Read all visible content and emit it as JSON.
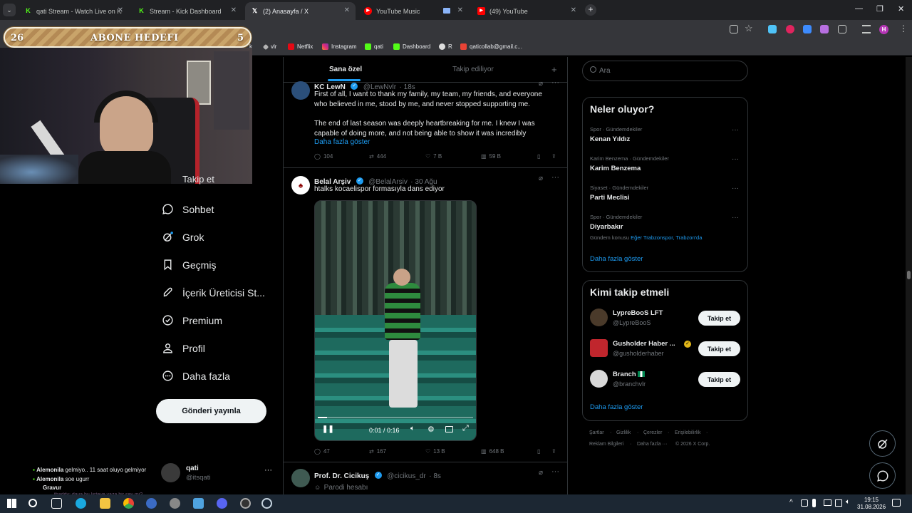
{
  "browser": {
    "tabs": [
      {
        "label": "qati Stream - Watch Live on Kick",
        "icon": "kick-icon",
        "color": "#53fc18"
      },
      {
        "label": "Stream - Kick Dashboard",
        "icon": "kick-icon",
        "color": "#53fc18"
      },
      {
        "label": "(2) Anasayfa / X",
        "icon": "x-icon",
        "color": "#ffffff"
      },
      {
        "label": "YouTube Music",
        "icon": "youtube-music-icon",
        "color": "#ff0000"
      },
      {
        "label": "(49) YouTube",
        "icon": "youtube-icon",
        "color": "#ff0000"
      }
    ],
    "bookmarks": [
      "vlr",
      "Netflix",
      "Instagram",
      "qati",
      "Dashboard",
      "R",
      "qaticollab@gmail.c..."
    ],
    "bookmark_partial": "k"
  },
  "overlay": {
    "goal_title": "ABONE HEDEFI",
    "goal_left": "26",
    "goal_right": "5"
  },
  "x_nav": {
    "partial_item": "Takip et",
    "items": [
      {
        "label": "Sohbet",
        "icon": "chat-icon"
      },
      {
        "label": "Grok",
        "icon": "grok-icon"
      },
      {
        "label": "Geçmiş",
        "icon": "bookmark-icon"
      },
      {
        "label": "İçerik Üreticisi St...",
        "icon": "rocket-icon"
      },
      {
        "label": "Premium",
        "icon": "premium-icon"
      },
      {
        "label": "Profil",
        "icon": "profile-icon"
      },
      {
        "label": "Daha fazla",
        "icon": "more-icon"
      }
    ],
    "post_button": "Gönderi yayınla",
    "account": {
      "name": "qati",
      "handle": "@itsqati"
    }
  },
  "timeline": {
    "tabs": [
      "Sana özel",
      "Takip ediliyor"
    ],
    "tweets": [
      {
        "name": "KC LewN",
        "handle": "@LewNvlr",
        "time": "18s",
        "text1": "First of all, I want to thank my family, my team, my friends, and everyone who believed in me, stood by me, and never stopped supporting me.",
        "text2": "The end of last season was deeply heartbreaking for me. I knew I was capable of doing more, and not being able to show it was incredibly",
        "more": "Daha fazla göster",
        "replies": "104",
        "reposts": "444",
        "likes": "7 B",
        "views": "59 B"
      },
      {
        "name": "Belal Arşiv",
        "handle": "@BelalArsiv",
        "time": "30 Ağu",
        "text1": "htalks kocaelispor formasıyla dans ediyor",
        "video_time": "0:01 / 0:16",
        "video_progress": 0.06,
        "replies": "47",
        "reposts": "167",
        "likes": "13 B",
        "views": "648 B"
      },
      {
        "name": "Prof. Dr. Cicikuş",
        "handle": "@cicikus_dr",
        "time": "8s",
        "text1": "Parodi hesabı"
      }
    ]
  },
  "right": {
    "search_placeholder": "Ara",
    "trends_title": "Neler oluyor?",
    "trends": [
      {
        "context": "Spor · Gündemdekiler",
        "name": "Kenan Yıldız"
      },
      {
        "context": "Karim Benzema · Gündemdekiler",
        "name": "Karim Benzema"
      },
      {
        "context": "Siyaset · Gündemdekiler",
        "name": "Parti Meclisi"
      },
      {
        "context": "Spor · Gündemdekiler",
        "name": "Diyarbakır",
        "topic_prefix": "Gündem konusu",
        "topic": "Eğer Trabzonspor, Trabzon'da"
      }
    ],
    "show_more": "Daha fazla göster",
    "follow_title": "Kimi takip etmeli",
    "follow": [
      {
        "name": "LypreBooS LFT",
        "handle": "@LypreBooS",
        "avatar_color": "#4a3a2a"
      },
      {
        "name": "Gusholder Haber ...",
        "handle": "@gusholderhaber",
        "avatar_color": "#c0262d"
      },
      {
        "name": "Branch",
        "handle": "@branchvlr",
        "avatar_color": "#d8d8d8"
      }
    ],
    "follow_button": "Takip et",
    "footer": [
      "Şartlar",
      "Gizlilik",
      "Çerezler",
      "Erişilebilirlik",
      "Reklam Bilgileri",
      "Daha fazla ···",
      "© 2026 X Corp."
    ]
  },
  "chat": [
    {
      "user": "Alemonila",
      "msg": "gelmiyo.. 11 saat oluyo gelmiyor"
    },
    {
      "user": "Alemonila",
      "msg": "soe ugurr"
    },
    {
      "user": "Gravur",
      "msg": ""
    },
    {
      "user": "",
      "msg": "thaddy: daya bu listeye yaza bir şey mi?"
    }
  ],
  "taskbar": {
    "time": "19:15",
    "date": "31.08.2026"
  }
}
